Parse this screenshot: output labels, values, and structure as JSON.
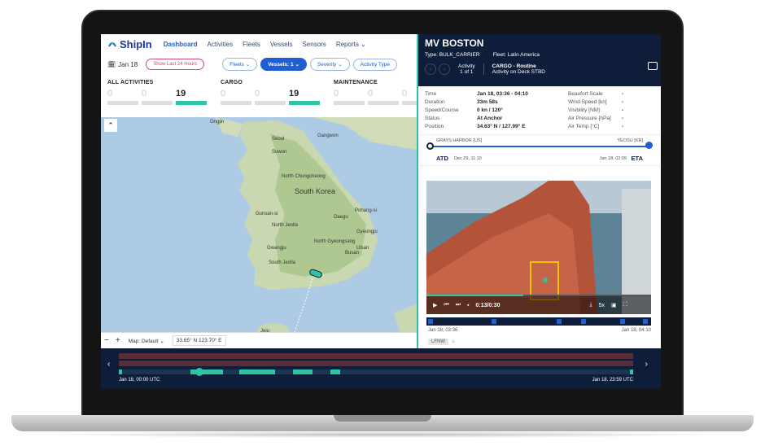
{
  "app": {
    "logo_text": "ShipIn",
    "nav": [
      "Dashboard",
      "Activities",
      "Fleets",
      "Vessels",
      "Sensors",
      "Reports"
    ],
    "active_nav": "Dashboard"
  },
  "filters": {
    "date": "Jan 18",
    "show_last": "Show Last 24 Hours",
    "fleets": "Fleets",
    "vessels": "Vessels: 1",
    "severity": "Severity",
    "activity_type": "Activity Type"
  },
  "stats": [
    {
      "title": "ALL ACTIVITIES",
      "values": [
        "0",
        "0",
        "19"
      ]
    },
    {
      "title": "CARGO",
      "values": [
        "0",
        "0",
        "19"
      ]
    },
    {
      "title": "MAINTENANCE",
      "values": [
        "0",
        "0",
        "0"
      ]
    }
  ],
  "map": {
    "labels": [
      "Ongjin",
      "Seoul",
      "Gangwon",
      "Suwon",
      "North Chungcheong",
      "South Korea",
      "Gunsan-si",
      "Daegu",
      "Pohang-si",
      "North Jeolla",
      "Gyeongju",
      "North Gyeongsang",
      "Gwangju",
      "Ulsan",
      "Busan",
      "South Jeolla",
      "Jeju"
    ],
    "style": "Map: Default",
    "coords": "33.65° N  123.70° E",
    "zoom_minus": "−",
    "zoom_plus": "+"
  },
  "vessel": {
    "name": "MV BOSTON",
    "type": "Type: BULK_CARRIER",
    "fleet": "Fleet: Latin America",
    "activity_label": "Activity",
    "activity_count": "1 of 1",
    "activity_title": "CARGO - Routine",
    "activity_sub": "Activity on Deck STBD"
  },
  "info": {
    "rows": [
      {
        "k": "Time",
        "v": "Jan 18, 03:36 - 04:10",
        "k2": "Beaufort Scale",
        "v2": "-"
      },
      {
        "k": "Duration",
        "v": "33m 58s",
        "k2": "Wind Speed [kn]",
        "v2": "-"
      },
      {
        "k": "Speed/Course",
        "v": "0 kn / 120°",
        "k2": "Visibility [NM]",
        "v2": "-"
      },
      {
        "k": "Status",
        "v": "At Anchor",
        "k2": "Air Pressure [hPa]",
        "v2": "-"
      },
      {
        "k": "Position",
        "v": "34.63° N / 127.99° E",
        "k2": "Air Temp [°C]",
        "v2": "-"
      }
    ]
  },
  "route": {
    "from": "GRAYS HARBOR [US]",
    "to": "YEOSU [KR]",
    "atd_label": "ATD",
    "atd_date": "Dec 29, 11:10",
    "eta_label": "ETA",
    "eta_date": "Jan 18, 02:09"
  },
  "video": {
    "time": "0:13/0:30",
    "speed": "5x",
    "start": "Jan 18, 03:36",
    "end": "Jan 18, 04:10",
    "tag": "LFNW"
  },
  "timeline": {
    "start": "Jan 18, 00:00 UTC",
    "end": "Jan 18, 23:59 UTC"
  },
  "colors": {
    "accent": "#2ec4a5",
    "navy": "#0e1d39",
    "brand": "#1f5fd1"
  }
}
